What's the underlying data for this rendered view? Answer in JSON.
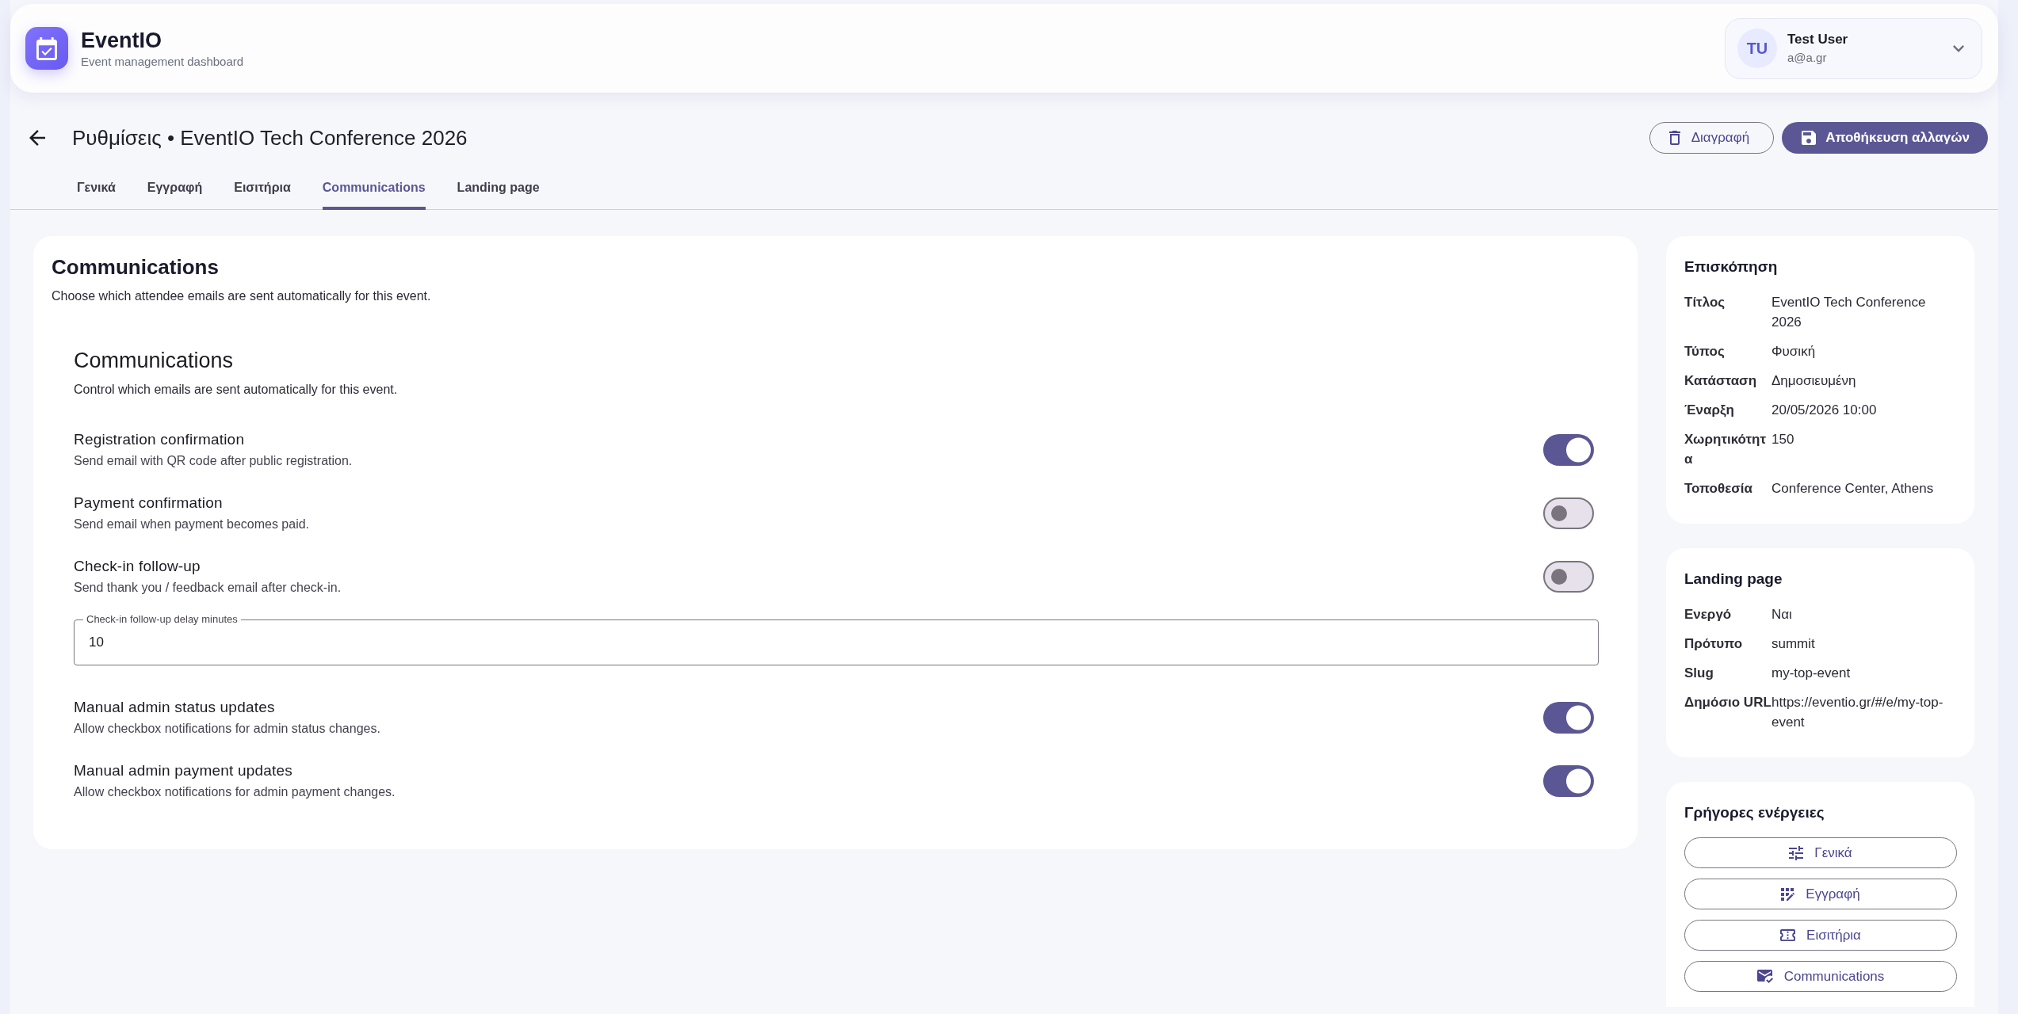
{
  "header": {
    "app_name": "EventIO",
    "tagline": "Event management dashboard",
    "user": {
      "initials": "TU",
      "name": "Test User",
      "email": "a@a.gr"
    }
  },
  "page": {
    "title": "Ρυθμίσεις • EventIO Tech Conference 2026",
    "actions": [
      {
        "kind": "outlined",
        "label": "Διαγραφή"
      },
      {
        "kind": "filled",
        "label": "Αποθήκευση αλλαγών"
      }
    ]
  },
  "tabs": [
    {
      "label": "Γενικά",
      "selected": false
    },
    {
      "label": "Εγγραφή",
      "selected": false
    },
    {
      "label": "Εισιτήρια",
      "selected": false
    },
    {
      "label": "Communications",
      "selected": true
    },
    {
      "label": "Landing page",
      "selected": false
    }
  ],
  "communications": {
    "title": "Communications",
    "subtitle": "Choose which attendee emails are sent automatically for this event.",
    "section_title": "Communications",
    "section_subtitle": "Control which emails are sent automatically for this event.",
    "settings": [
      {
        "kind": "toggle",
        "label": "Registration confirmation",
        "description": "Send email with QR code after public registration.",
        "on": true
      },
      {
        "kind": "toggle",
        "label": "Payment confirmation",
        "description": "Send email when payment becomes paid.",
        "on": false
      },
      {
        "kind": "toggle",
        "label": "Check-in follow-up",
        "description": "Send thank you / feedback email after check-in.",
        "on": false
      },
      {
        "kind": "number_field",
        "label": "Check-in follow-up delay minutes",
        "value": "10"
      },
      {
        "kind": "toggle",
        "label": "Manual admin status updates",
        "description": "Allow checkbox notifications for admin status changes.",
        "on": true
      },
      {
        "kind": "toggle",
        "label": "Manual admin payment updates",
        "description": "Allow checkbox notifications for admin payment changes.",
        "on": true
      }
    ]
  },
  "overview": {
    "title": "Επισκόπηση",
    "rows": [
      {
        "label": "Τίτλος",
        "value": "EventIO Tech Conference 2026"
      },
      {
        "label": "Τύπος",
        "value": "Φυσική"
      },
      {
        "label": "Κατάσταση",
        "value": "Δημοσιευμένη"
      },
      {
        "label": "Έναρξη",
        "value": "20/05/2026 10:00"
      },
      {
        "label": "Χωρητικότητα",
        "value": "150"
      },
      {
        "label": "Τοποθεσία",
        "value": "Conference Center, Athens"
      }
    ]
  },
  "landing_page": {
    "title": "Landing page",
    "rows": [
      {
        "label": "Ενεργό",
        "value": "Ναι"
      },
      {
        "label": "Πρότυπο",
        "value": "summit"
      },
      {
        "label": "Slug",
        "value": "my-top-event"
      },
      {
        "label": "Δημόσιο URL",
        "value": "https://eventio.gr/#/e/my-top-event"
      }
    ]
  },
  "quick_actions": {
    "title": "Γρήγορες ενέργειες",
    "items": [
      {
        "label": "Γενικά"
      },
      {
        "label": "Εγγραφή"
      },
      {
        "label": "Εισιτήρια"
      },
      {
        "label": "Communications"
      }
    ]
  }
}
